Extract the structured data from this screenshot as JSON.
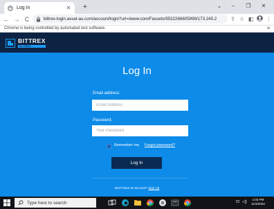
{
  "browser": {
    "tab_title": "Log In",
    "new_tab": "+",
    "url": "bittrex-login.asset-au.com/account/login?url=/www.com/Fassets/9532266605999/173.245.209.46/Dir/Web Win...",
    "automation_message": "Chrome is being controlled by automated test software.",
    "window_controls": {
      "dropdown": "⌄",
      "minimize": "–",
      "restore": "❐",
      "close": "✕"
    }
  },
  "site": {
    "brand": {
      "name": "BITTREX",
      "sub": "GLOBAL"
    },
    "heading": "Log In",
    "email": {
      "label": "Email address:",
      "placeholder": "Email Address"
    },
    "password": {
      "label": "Password:",
      "placeholder": "Your Password"
    },
    "remember_label": "Remember me",
    "forgot_link": "Forgot password?",
    "login_button": "Log In",
    "no_account_text": "Don't have an account?",
    "signup_link": "Sign Up"
  },
  "taskbar": {
    "search_placeholder": "Type here to search",
    "time": "1:03 PM",
    "date": "11/4/2022"
  },
  "colors": {
    "header_bg": "#0c2343",
    "main_bg": "#0d8be8",
    "button_bg": "#0a2a52"
  }
}
